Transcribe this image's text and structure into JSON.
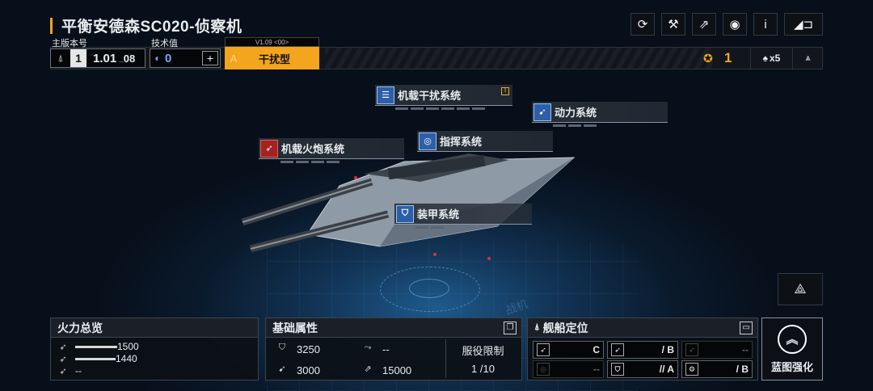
{
  "header": {
    "title": "平衡安德森SC020-侦察机",
    "buttons": [
      {
        "name": "refresh-icon",
        "glyph": "⟳"
      },
      {
        "name": "tool-icon",
        "glyph": "⚒"
      },
      {
        "name": "external-link-icon",
        "glyph": "⇗"
      },
      {
        "name": "view-icon",
        "glyph": "◉"
      },
      {
        "name": "info-icon",
        "glyph": "i"
      },
      {
        "name": "back-icon",
        "glyph": "◢⊐"
      }
    ]
  },
  "info": {
    "version_label": "主版本号",
    "version_num": "1",
    "version_value": "1.01",
    "version_sub": "08",
    "tech_label": "技术值",
    "tech_value": "0",
    "tech_add": "+",
    "ship_version": "V1.09 <00>",
    "grade_letter": "A",
    "type_label": "干扰型",
    "count_value": "1",
    "multiplier": "x5"
  },
  "systems": {
    "jamming": "机载干扰系统",
    "power": "动力系统",
    "command": "指挥系统",
    "cannon": "机载火炮系统",
    "armor": "装甲系统"
  },
  "firepower": {
    "title": "火力总览",
    "rows": [
      {
        "value": "1500",
        "fraction": 0.52
      },
      {
        "value": "1440",
        "fraction": 0.5
      },
      {
        "value": "--",
        "fraction": 0
      }
    ]
  },
  "base_attributes": {
    "title": "基础属性",
    "hp": "3250",
    "evasion": "--",
    "armor": "3000",
    "speed": "15000",
    "limit_label": "服役限制",
    "limit_value": "1 /10"
  },
  "positioning": {
    "title": "舰船定位",
    "cells": [
      {
        "grade": "C",
        "dim": false
      },
      {
        "grade": "/ B",
        "dim": false
      },
      {
        "grade": "--",
        "dim": true
      },
      {
        "grade": "--",
        "dim": true
      },
      {
        "grade": "// A",
        "dim": false
      },
      {
        "grade": "/ B",
        "dim": false
      }
    ]
  },
  "upgrade": {
    "label": "蓝图强化"
  },
  "watermark": "战机"
}
